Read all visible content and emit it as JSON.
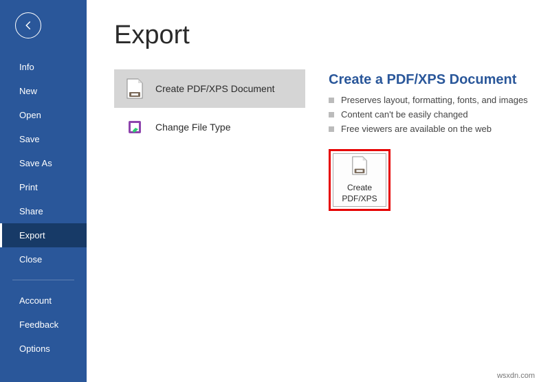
{
  "sidebar": {
    "items": [
      {
        "id": "info",
        "label": "Info"
      },
      {
        "id": "new",
        "label": "New"
      },
      {
        "id": "open",
        "label": "Open"
      },
      {
        "id": "save",
        "label": "Save"
      },
      {
        "id": "save-as",
        "label": "Save As"
      },
      {
        "id": "print",
        "label": "Print"
      },
      {
        "id": "share",
        "label": "Share"
      },
      {
        "id": "export",
        "label": "Export",
        "selected": true
      },
      {
        "id": "close",
        "label": "Close"
      }
    ],
    "footer": [
      {
        "id": "account",
        "label": "Account"
      },
      {
        "id": "feedback",
        "label": "Feedback"
      },
      {
        "id": "options",
        "label": "Options"
      }
    ]
  },
  "main": {
    "title": "Export",
    "options": [
      {
        "id": "create-pdf",
        "label": "Create PDF/XPS Document",
        "selected": true
      },
      {
        "id": "change-type",
        "label": "Change File Type"
      }
    ],
    "detail": {
      "title": "Create a PDF/XPS Document",
      "bullets": [
        "Preserves layout, formatting, fonts, and images",
        "Content can't be easily changed",
        "Free viewers are available on the web"
      ],
      "action_label": "Create PDF/XPS"
    }
  },
  "watermark": "wsxdn.com"
}
